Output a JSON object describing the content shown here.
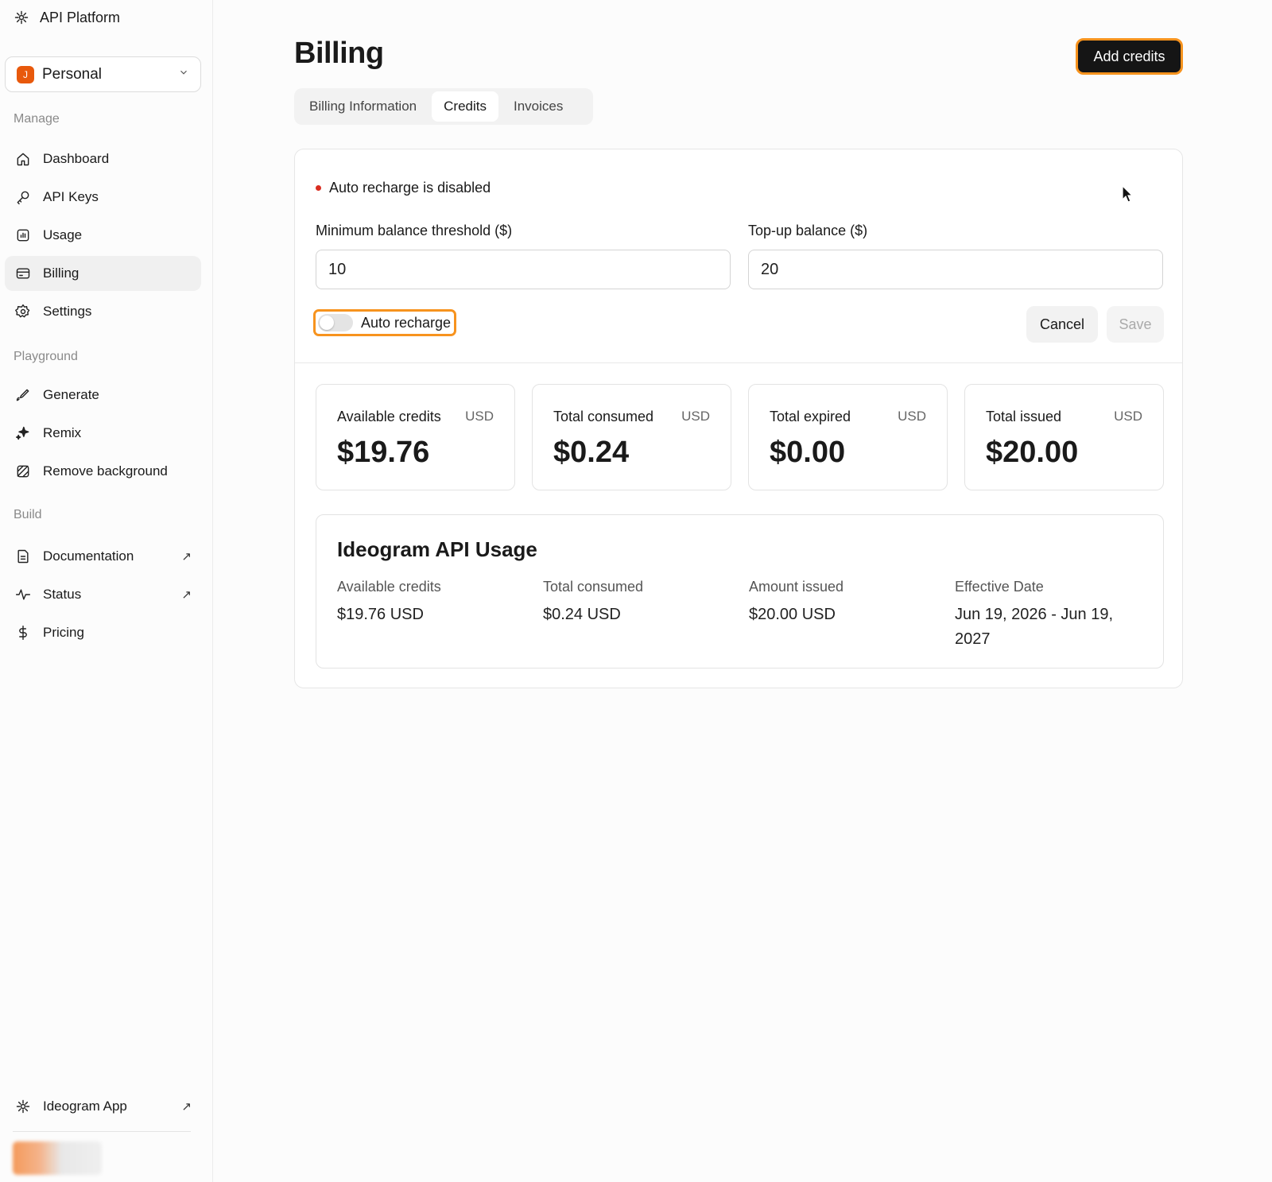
{
  "brand": {
    "title": "API Platform",
    "icon": "ideogram-logo-icon"
  },
  "workspace": {
    "initial": "J",
    "name": "Personal",
    "accent": "#e8590c"
  },
  "sidebar": {
    "sections": {
      "manage": "Manage",
      "playground": "Playground",
      "build": "Build"
    },
    "items": [
      {
        "label": "Dashboard",
        "icon": "home-icon"
      },
      {
        "label": "API Keys",
        "icon": "key-icon"
      },
      {
        "label": "Usage",
        "icon": "chart-icon"
      },
      {
        "label": "Billing",
        "icon": "card-icon",
        "active": true
      },
      {
        "label": "Settings",
        "icon": "gear-icon"
      },
      {
        "label": "Generate",
        "icon": "brush-icon"
      },
      {
        "label": "Remix",
        "icon": "sparkle-icon"
      },
      {
        "label": "Remove background",
        "icon": "hatch-square-icon"
      },
      {
        "label": "Documentation",
        "icon": "document-icon",
        "external": "↗"
      },
      {
        "label": "Status",
        "icon": "pulse-icon",
        "external": "↗"
      },
      {
        "label": "Pricing",
        "icon": "dollar-icon"
      }
    ],
    "footer": {
      "label": "Ideogram App",
      "external": "↗"
    }
  },
  "page": {
    "title": "Billing",
    "add_credits_label": "Add credits",
    "tabs": [
      "Billing Information",
      "Credits",
      "Invoices"
    ],
    "active_tab": "Credits"
  },
  "auto_recharge": {
    "status_text": "Auto recharge is disabled",
    "status_color": "#d92d20",
    "min_label": "Minimum balance threshold ($)",
    "min_value": "10",
    "topup_label": "Top-up balance ($)",
    "topup_value": "20",
    "toggle_label": "Auto recharge",
    "toggle_on": false,
    "cancel_label": "Cancel",
    "save_label": "Save"
  },
  "stats": [
    {
      "label": "Available credits",
      "unit": "USD",
      "value": "$19.76"
    },
    {
      "label": "Total consumed",
      "unit": "USD",
      "value": "$0.24"
    },
    {
      "label": "Total expired",
      "unit": "USD",
      "value": "$0.00"
    },
    {
      "label": "Total issued",
      "unit": "USD",
      "value": "$20.00"
    }
  ],
  "usage": {
    "title": "Ideogram API Usage",
    "columns": [
      {
        "label": "Available credits",
        "value": "$19.76 USD"
      },
      {
        "label": "Total consumed",
        "value": "$0.24 USD"
      },
      {
        "label": "Amount issued",
        "value": "$20.00 USD"
      },
      {
        "label": "Effective Date",
        "value": "Jun 19, 2026 - Jun 19, 2027"
      }
    ]
  },
  "highlight_color": "#f7931e"
}
